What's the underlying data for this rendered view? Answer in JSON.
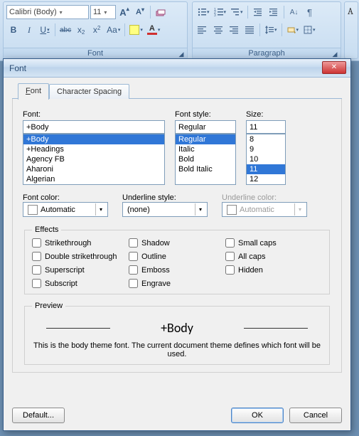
{
  "ribbon": {
    "font_group_label": "Font",
    "paragraph_group_label": "Paragraph",
    "font_name": "Calibri (Body)",
    "font_size": "11",
    "grow": "A",
    "shrink": "A",
    "bold": "B",
    "italic": "I",
    "underline": "U",
    "strike": "abc",
    "sub": "x",
    "sup": "x",
    "case": "Aa",
    "fontcolorA": "A"
  },
  "dialog": {
    "title": "Font",
    "tabs": {
      "font": "Font",
      "spacing": "Character Spacing"
    },
    "labels": {
      "font": "Font:",
      "font_style": "Font style:",
      "size": "Size:",
      "font_color": "Font color:",
      "underline_style": "Underline style:",
      "underline_color": "Underline color:",
      "effects": "Effects",
      "preview": "Preview"
    },
    "font_value": "+Body",
    "font_list": [
      "+Body",
      "+Headings",
      "Agency FB",
      "Aharoni",
      "Algerian"
    ],
    "font_selected": "+Body",
    "style_value": "Regular",
    "style_list": [
      "Regular",
      "Italic",
      "Bold",
      "Bold Italic"
    ],
    "style_selected": "Regular",
    "size_value": "11",
    "size_list": [
      "8",
      "9",
      "10",
      "11",
      "12"
    ],
    "size_selected": "11",
    "font_color_value": "Automatic",
    "underline_style_value": "(none)",
    "underline_color_value": "Automatic",
    "effects_list": {
      "col1": [
        "Strikethrough",
        "Double strikethrough",
        "Superscript",
        "Subscript"
      ],
      "col2": [
        "Shadow",
        "Outline",
        "Emboss",
        "Engrave"
      ],
      "col3": [
        "Small caps",
        "All caps",
        "Hidden"
      ]
    },
    "preview_text": "+Body",
    "preview_desc": "This is the body theme font. The current document theme defines which font will be used.",
    "buttons": {
      "default": "Default...",
      "ok": "OK",
      "cancel": "Cancel"
    }
  }
}
